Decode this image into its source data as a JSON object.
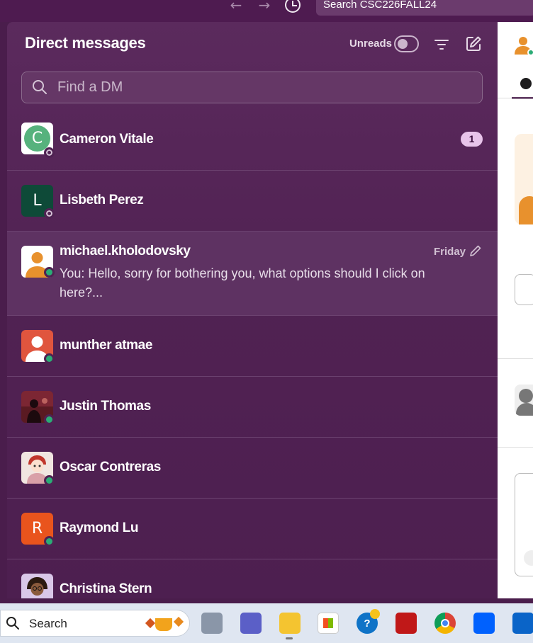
{
  "topbar": {
    "back_glyph": "←",
    "forward_glyph": "→",
    "search_placeholder": "Search CSC226FALL24"
  },
  "panel": {
    "title": "Direct messages",
    "unreads_label": "Unreads",
    "find_placeholder": "Find a DM"
  },
  "dms": [
    {
      "name": "Cameron Vitale",
      "letter": "C",
      "avatar_color": "#56b27d",
      "status": "away",
      "badge": "1"
    },
    {
      "name": "Lisbeth Perez",
      "letter": "L",
      "avatar_color": "#0e4a38",
      "status": "away"
    },
    {
      "name": "michael.kholodovsky",
      "avatar_color": "#e8912d",
      "status": "online",
      "day": "Friday",
      "preview": "You: Hello, sorry for bothering you, what options should I click on here?..."
    },
    {
      "name": "munther atmae",
      "avatar_color": "#e0553e",
      "status": "online"
    },
    {
      "name": "Justin Thomas",
      "avatar_color": "#5a1a22",
      "status": "online"
    },
    {
      "name": "Oscar Contreras",
      "avatar_color": "#f1e6e1",
      "status": "online"
    },
    {
      "name": "Raymond Lu",
      "letter": "R",
      "avatar_color": "#e9541d",
      "status": "online"
    },
    {
      "name": "Christina Stern",
      "avatar_color": "#d9c7e8",
      "status": "online"
    }
  ],
  "taskbar": {
    "search_label": "Search"
  }
}
